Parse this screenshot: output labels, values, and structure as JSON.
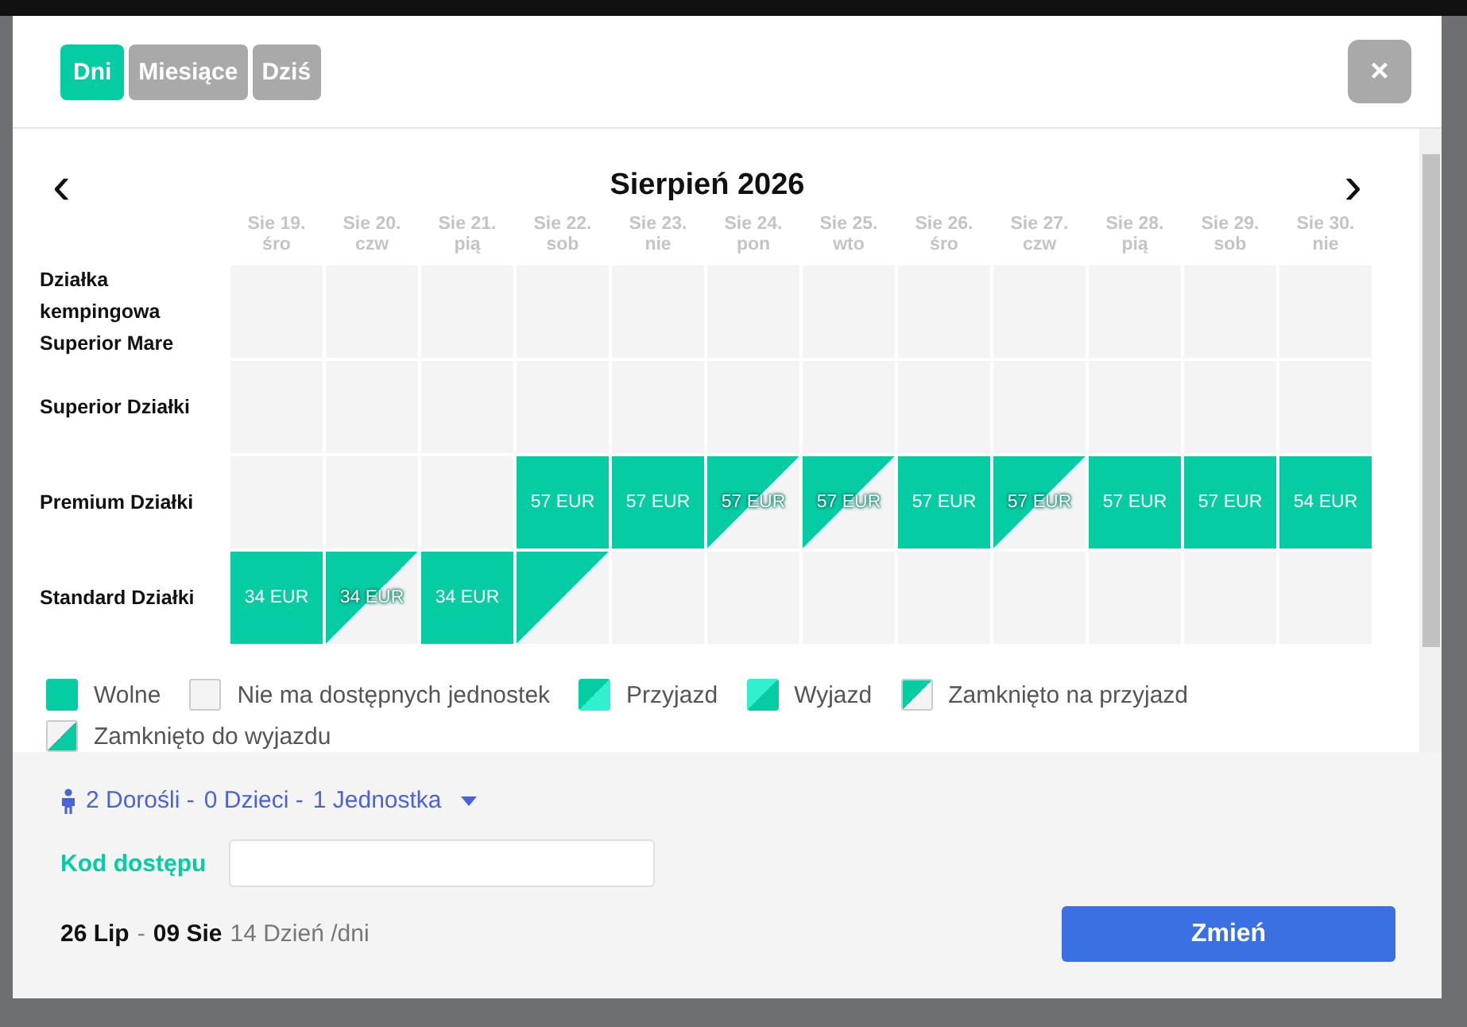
{
  "view_tabs": [
    {
      "label": "Dni",
      "selected": true
    },
    {
      "label": "Miesiące",
      "selected": false
    },
    {
      "label": "Dziś",
      "selected": false
    }
  ],
  "close_button": "×",
  "calendar": {
    "prev": "‹",
    "next": "›",
    "month": "Sierpień 2026",
    "days": [
      {
        "date": "Sie 19.",
        "weekday": "śro"
      },
      {
        "date": "Sie 20.",
        "weekday": "czw"
      },
      {
        "date": "Sie 21.",
        "weekday": "pią"
      },
      {
        "date": "Sie 22.",
        "weekday": "sob"
      },
      {
        "date": "Sie 23.",
        "weekday": "nie"
      },
      {
        "date": "Sie 24.",
        "weekday": "pon"
      },
      {
        "date": "Sie 25.",
        "weekday": "wto"
      },
      {
        "date": "Sie 26.",
        "weekday": "śro"
      },
      {
        "date": "Sie 27.",
        "weekday": "czw"
      },
      {
        "date": "Sie 28.",
        "weekday": "pią"
      },
      {
        "date": "Sie 29.",
        "weekday": "sob"
      },
      {
        "date": "Sie 30.",
        "weekday": "nie"
      }
    ],
    "units": [
      {
        "name": "Działka kempingowa Superior Mare",
        "cells": [
          {
            "kind": "none"
          },
          {
            "kind": "none"
          },
          {
            "kind": "none"
          },
          {
            "kind": "none"
          },
          {
            "kind": "none"
          },
          {
            "kind": "none"
          },
          {
            "kind": "none"
          },
          {
            "kind": "none"
          },
          {
            "kind": "none"
          },
          {
            "kind": "none"
          },
          {
            "kind": "none"
          },
          {
            "kind": "none"
          }
        ]
      },
      {
        "name": "Superior Działki",
        "cells": [
          {
            "kind": "none"
          },
          {
            "kind": "none"
          },
          {
            "kind": "none"
          },
          {
            "kind": "none"
          },
          {
            "kind": "none"
          },
          {
            "kind": "none"
          },
          {
            "kind": "none"
          },
          {
            "kind": "none"
          },
          {
            "kind": "none"
          },
          {
            "kind": "none"
          },
          {
            "kind": "none"
          },
          {
            "kind": "none"
          }
        ]
      },
      {
        "name": "Premium Działki",
        "cells": [
          {
            "kind": "none"
          },
          {
            "kind": "none"
          },
          {
            "kind": "none"
          },
          {
            "kind": "free",
            "price": "57 EUR"
          },
          {
            "kind": "free",
            "price": "57 EUR"
          },
          {
            "kind": "half",
            "price": "57 EUR"
          },
          {
            "kind": "half",
            "price": "57 EUR"
          },
          {
            "kind": "free",
            "price": "57 EUR"
          },
          {
            "kind": "half",
            "price": "57 EUR"
          },
          {
            "kind": "free",
            "price": "57 EUR"
          },
          {
            "kind": "free",
            "price": "57 EUR"
          },
          {
            "kind": "free",
            "price": "54 EUR"
          }
        ]
      },
      {
        "name": "Standard Działki",
        "cells": [
          {
            "kind": "free",
            "price": "34 EUR"
          },
          {
            "kind": "half",
            "price": "34 EUR"
          },
          {
            "kind": "free",
            "price": "34 EUR"
          },
          {
            "kind": "half"
          },
          {
            "kind": "none"
          },
          {
            "kind": "none"
          },
          {
            "kind": "none"
          },
          {
            "kind": "none"
          },
          {
            "kind": "none"
          },
          {
            "kind": "none"
          },
          {
            "kind": "none"
          },
          {
            "kind": "none"
          }
        ]
      }
    ]
  },
  "legend": [
    {
      "kind": "free",
      "label": "Wolne"
    },
    {
      "kind": "none",
      "label": "Nie ma dostępnych jednostek"
    },
    {
      "kind": "arrival",
      "label": "Przyjazd"
    },
    {
      "kind": "departure",
      "label": "Wyjazd"
    },
    {
      "kind": "closed_arrival",
      "label": "Zamknięto na przyjazd"
    },
    {
      "kind": "closed_departure",
      "label": "Zamknięto do wyjazdu"
    }
  ],
  "guests": [
    "2 Dorośli -",
    "0 Dzieci -",
    "1 Jednostka"
  ],
  "access_code": {
    "label": "Kod dostępu"
  },
  "stay": {
    "from": "26 Lip",
    "separator": "-",
    "to": "09 Sie",
    "length": "14 Dzień /dni"
  },
  "submit_button": "Zmień"
}
